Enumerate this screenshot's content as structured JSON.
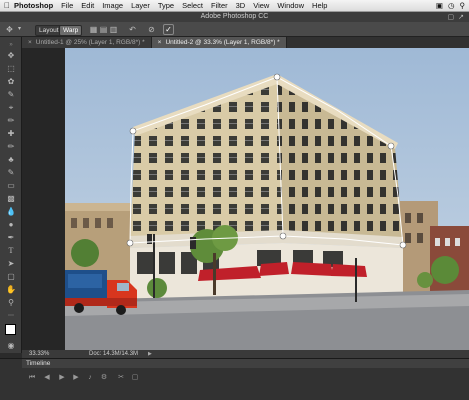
{
  "menu_bar": {
    "apple_icon": "apple-logo-icon",
    "items": [
      "Photoshop",
      "File",
      "Edit",
      "Image",
      "Layer",
      "Type",
      "Select",
      "Filter",
      "3D",
      "View",
      "Window",
      "Help"
    ]
  },
  "window": {
    "title": "Adobe Photoshop CC"
  },
  "options_bar": {
    "layout_label": "Layout",
    "warp_label": "Warp"
  },
  "tabs": [
    {
      "label": "Untitled-1 @ 25% (Layer 1, RGB/8*) *"
    },
    {
      "label": "Untitled-2 @ 33.3% (Layer 1, RGB/8*) *"
    }
  ],
  "status_bar": {
    "zoom": "33.33%",
    "doc_size": "Doc: 14.3M/14.3M"
  },
  "timeline": {
    "label": "Timeline"
  },
  "colors": {
    "sky": "#b7c9dc",
    "building": "#d6c9a8",
    "awning": "#c0202a",
    "truck": "#d8361e",
    "warp_grid": "#ffffff"
  }
}
